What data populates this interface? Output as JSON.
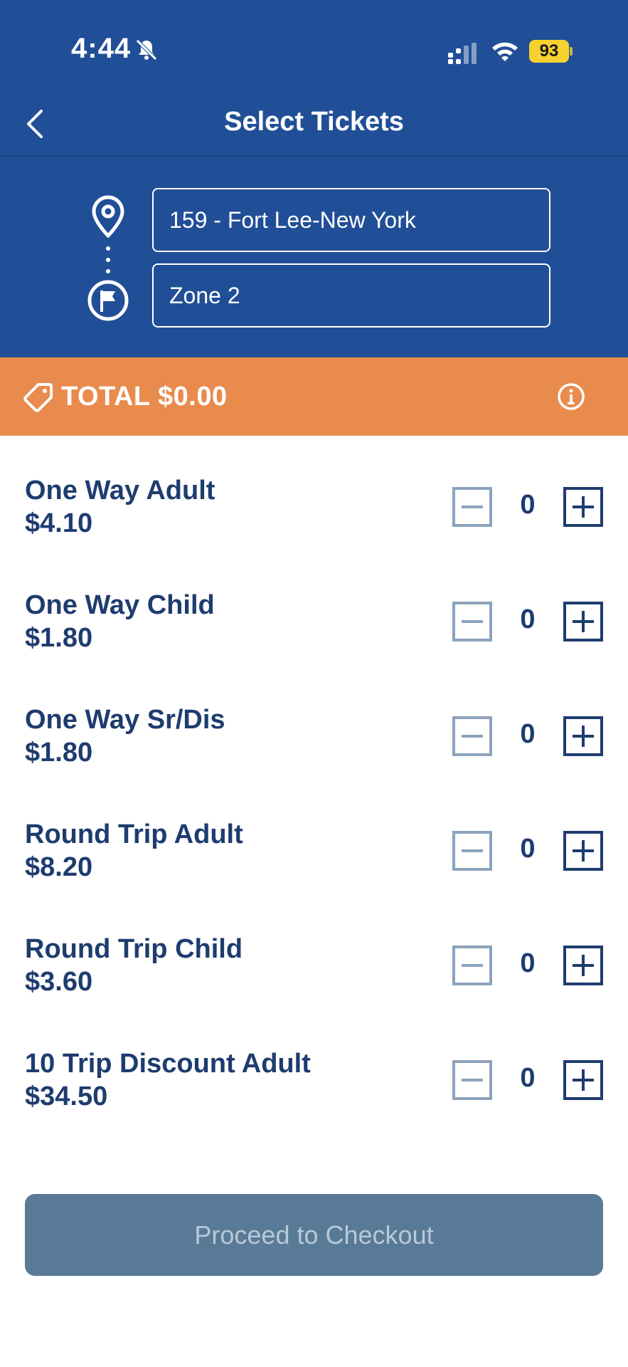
{
  "status_bar": {
    "time": "4:44",
    "battery": "93"
  },
  "header": {
    "title": "Select Tickets"
  },
  "route": {
    "origin": "159 - Fort Lee-New York",
    "destination": "Zone 2"
  },
  "total": {
    "label": "TOTAL $0.00"
  },
  "tickets": [
    {
      "name": "One Way Adult",
      "price": "$4.10",
      "qty": "0"
    },
    {
      "name": "One Way Child",
      "price": "$1.80",
      "qty": "0"
    },
    {
      "name": "One Way Sr/Dis",
      "price": "$1.80",
      "qty": "0"
    },
    {
      "name": "Round Trip Adult",
      "price": "$8.20",
      "qty": "0"
    },
    {
      "name": "Round Trip Child",
      "price": "$3.60",
      "qty": "0"
    },
    {
      "name": "10 Trip Discount Adult",
      "price": "$34.50",
      "qty": "0"
    }
  ],
  "checkout": {
    "label": "Proceed to Checkout"
  },
  "colors": {
    "header_blue": "#214f97",
    "total_orange": "#e98b4d",
    "text_navy": "#1e3c6f",
    "button_disabled": "#587a97",
    "battery_yellow": "#f6d130"
  },
  "icons": {
    "back": "chevron-left-icon",
    "origin": "location-pin-icon",
    "destination": "flag-icon",
    "total": "tag-icon",
    "info": "info-icon",
    "decrement": "minus-icon",
    "increment": "plus-icon"
  }
}
